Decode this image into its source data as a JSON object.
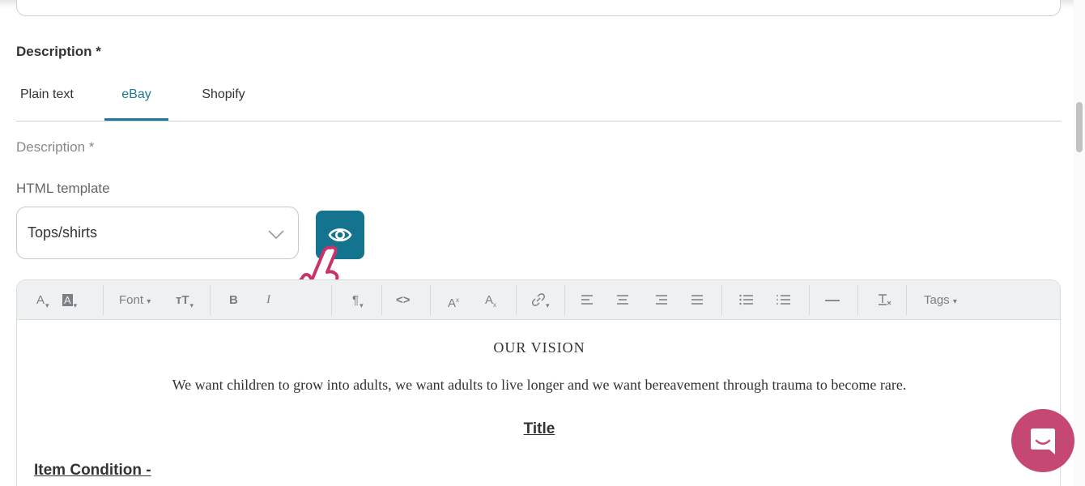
{
  "form": {
    "section_title": "Description *",
    "tabs": [
      {
        "label": "Plain text",
        "active": false
      },
      {
        "label": "eBay",
        "active": true
      },
      {
        "label": "Shopify",
        "active": false
      }
    ],
    "description_label": "Description *",
    "template_label": "HTML template",
    "template_select": {
      "value": "Tops/shirts"
    },
    "preview_button_icon": "eye-icon"
  },
  "toolbar": {
    "text_color": "A",
    "bg_color": "A",
    "font": "Font",
    "font_size": "тT",
    "bold": "B",
    "italic": "I",
    "paragraph": "¶",
    "code": "<>",
    "superscript": "A",
    "subscript": "A",
    "tags": "Tags"
  },
  "editor": {
    "heading": "OUR VISION",
    "paragraph": "We want children to grow into adults, we want adults to live longer and we want bereavement through trauma to become rare.",
    "title": "Title",
    "item_condition": "Item Condition -"
  },
  "colors": {
    "accent": "#14738e",
    "tab_active": "#1e7a94",
    "chat": "#c44774",
    "cursor": "#c8336a"
  }
}
